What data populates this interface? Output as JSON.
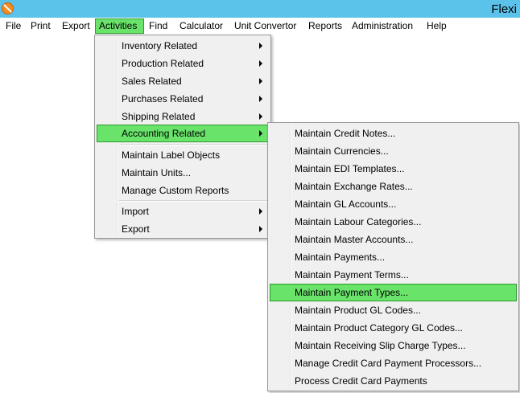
{
  "window": {
    "title": "Flexi"
  },
  "menubar": {
    "items": [
      {
        "label": "File"
      },
      {
        "label": "Print"
      },
      {
        "label": "Export"
      },
      {
        "label": "Activities"
      },
      {
        "label": "Find"
      },
      {
        "label": "Calculator"
      },
      {
        "label": "Unit Convertor"
      },
      {
        "label": "Reports"
      },
      {
        "label": "Administration"
      },
      {
        "label": "Help"
      }
    ]
  },
  "activities_menu": {
    "items": [
      {
        "label": "Inventory Related",
        "submenu": true
      },
      {
        "label": "Production Related",
        "submenu": true
      },
      {
        "label": "Sales Related",
        "submenu": true
      },
      {
        "label": "Purchases Related",
        "submenu": true
      },
      {
        "label": "Shipping Related",
        "submenu": true
      },
      {
        "label": "Accounting Related",
        "submenu": true
      },
      {
        "label": "Maintain Label Objects",
        "submenu": false
      },
      {
        "label": "Maintain Units...",
        "submenu": false
      },
      {
        "label": "Manage Custom Reports",
        "submenu": false
      },
      {
        "label": "Import",
        "submenu": true
      },
      {
        "label": "Export",
        "submenu": true
      }
    ]
  },
  "accounting_menu": {
    "items": [
      {
        "label": "Maintain Credit Notes..."
      },
      {
        "label": "Maintain Currencies..."
      },
      {
        "label": "Maintain EDI Templates..."
      },
      {
        "label": "Maintain Exchange Rates..."
      },
      {
        "label": "Maintain GL Accounts..."
      },
      {
        "label": "Maintain Labour Categories..."
      },
      {
        "label": "Maintain Master Accounts..."
      },
      {
        "label": "Maintain Payments..."
      },
      {
        "label": "Maintain Payment Terms..."
      },
      {
        "label": "Maintain Payment Types..."
      },
      {
        "label": "Maintain Product GL Codes..."
      },
      {
        "label": "Maintain Product Category GL Codes..."
      },
      {
        "label": "Maintain Receiving Slip Charge Types..."
      },
      {
        "label": "Manage Credit Card Payment Processors..."
      },
      {
        "label": "Process Credit Card Payments"
      }
    ]
  },
  "colors": {
    "titlebar": "#5bc2ea",
    "highlight": "#69e36a",
    "highlight_border": "#2c9b2c",
    "menu_bg": "#f0f0f0"
  }
}
